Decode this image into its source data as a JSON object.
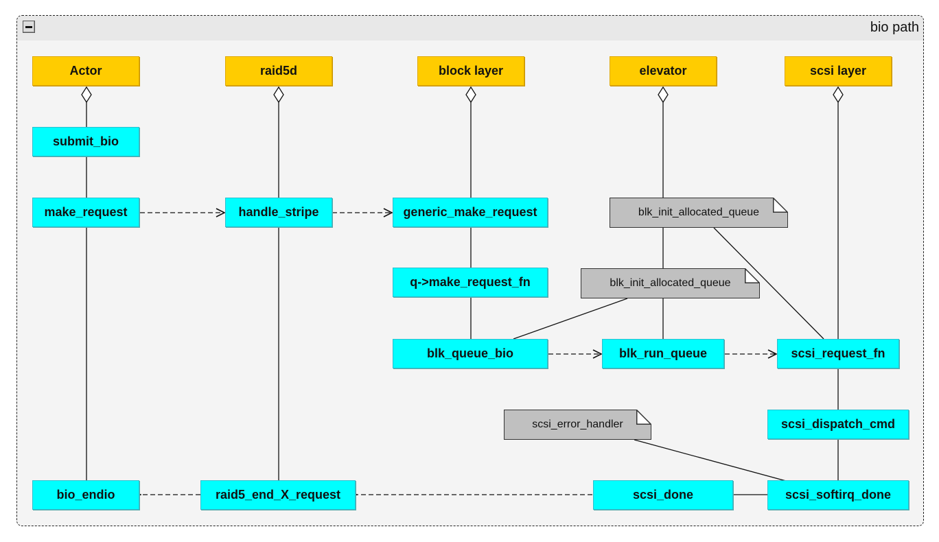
{
  "frame": {
    "title": "bio path",
    "collapse_icon": "minus-square-icon"
  },
  "colors": {
    "actor": "#ffcc00",
    "function": "#00ffff",
    "note": "#c0c0c0",
    "background": "#f4f4f4"
  },
  "lifelines": [
    {
      "id": "actor",
      "label": "Actor"
    },
    {
      "id": "raid5d",
      "label": "raid5d"
    },
    {
      "id": "block",
      "label": "block layer"
    },
    {
      "id": "elevator",
      "label": "elevator"
    },
    {
      "id": "scsi",
      "label": "scsi layer"
    }
  ],
  "functions": {
    "submit_bio": "submit_bio",
    "make_request": "make_request",
    "handle_stripe": "handle_stripe",
    "generic_make_request": "generic_make_request",
    "q_make_request_fn": "q->make_request_fn",
    "blk_queue_bio": "blk_queue_bio",
    "blk_run_queue": "blk_run_queue",
    "scsi_request_fn": "scsi_request_fn",
    "scsi_dispatch_cmd": "scsi_dispatch_cmd",
    "scsi_softirq_done": "scsi_softirq_done",
    "scsi_done": "scsi_done",
    "raid5_end_X_request": "raid5_end_X_request",
    "bio_endio": "bio_endio"
  },
  "notes": {
    "note1": "blk_init_allocated_queue",
    "note2": "blk_init_allocated_queue",
    "note3": "scsi_error_handler"
  },
  "edges": [
    {
      "from": "make_request",
      "to": "handle_stripe",
      "style": "dashed-open-arrow"
    },
    {
      "from": "handle_stripe",
      "to": "generic_make_request",
      "style": "dashed-open-arrow"
    },
    {
      "from": "blk_queue_bio",
      "to": "blk_run_queue",
      "style": "dashed-open-arrow"
    },
    {
      "from": "blk_run_queue",
      "to": "scsi_request_fn",
      "style": "dashed-open-arrow"
    },
    {
      "from": "scsi_done",
      "to": "raid5_end_X_request",
      "style": "dashed-hollow-triangle"
    },
    {
      "from": "raid5_end_X_request",
      "to": "bio_endio",
      "style": "dashed-hollow-triangle"
    },
    {
      "from": "scsi_softirq_done",
      "to": "scsi_done",
      "style": "solid"
    }
  ]
}
